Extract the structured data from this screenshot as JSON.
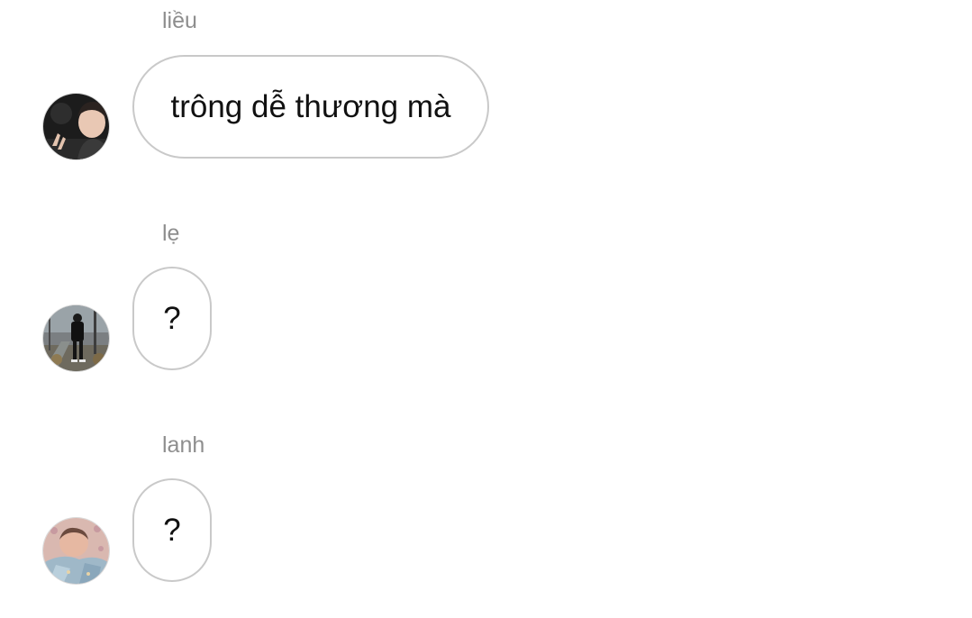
{
  "messages": [
    {
      "sender": "liều",
      "text": "trông dễ thương mà",
      "avatar": "avatar-dark-night-selfie"
    },
    {
      "sender": "lẹ",
      "text": "?",
      "avatar": "avatar-street-full-body"
    },
    {
      "sender": "lanh",
      "text": "?",
      "avatar": "avatar-baby-blanket"
    }
  ],
  "colors": {
    "sender_text": "#8e8e8e",
    "bubble_border": "#c9c9c9",
    "message_text": "#111111",
    "background": "#ffffff"
  }
}
